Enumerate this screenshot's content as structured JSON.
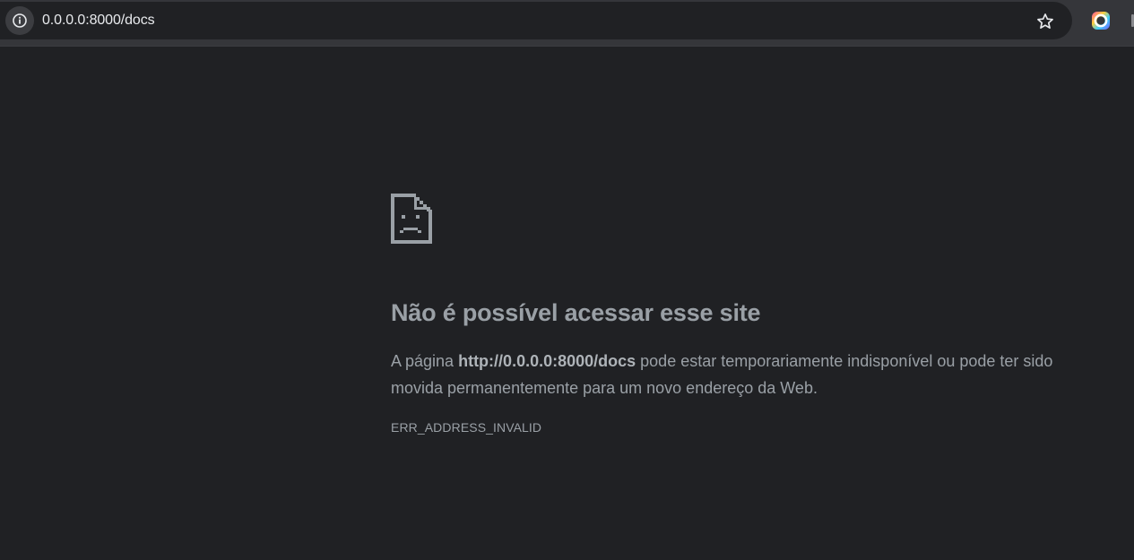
{
  "browser": {
    "address_bar": {
      "url": "0.0.0.0:8000/docs",
      "site_info_icon": "info-circle-icon",
      "bookmark_icon": "star-outline-icon"
    },
    "extension_icon": "colorful-ring-icon"
  },
  "error_page": {
    "icon": "sad-page-icon",
    "title": "Não é possível acessar esse site",
    "description_prefix": "A página ",
    "description_url": "http://0.0.0.0:8000/docs",
    "description_suffix": " pode estar temporariamente indisponível ou pode ter sido movida permanentemente para um novo endereço da Web.",
    "error_code": "ERR_ADDRESS_INVALID"
  },
  "colors": {
    "page_background": "#202124",
    "toolbar_background": "#35363a",
    "text": "#9aa0a6",
    "url_text": "#e8eaed"
  }
}
